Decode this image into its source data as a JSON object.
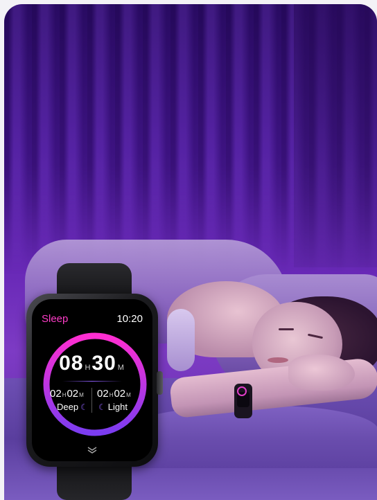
{
  "watch": {
    "title": "Sleep",
    "clock": "10:20",
    "total": {
      "hours": "08",
      "hours_unit": "H",
      "minutes": "30",
      "minutes_unit": "M"
    },
    "deep": {
      "hours": "02",
      "hours_unit": "H",
      "minutes": "02",
      "minutes_unit": "M",
      "label": "Deep"
    },
    "light": {
      "hours": "02",
      "hours_unit": "H",
      "minutes": "02",
      "minutes_unit": "M",
      "label": "Light"
    },
    "ring_colors": [
      "#ff2ed1",
      "#7b3cf0"
    ],
    "icons": {
      "deep": "moon-icon",
      "light": "moon-icon",
      "more": "chevron-down-icon"
    }
  }
}
